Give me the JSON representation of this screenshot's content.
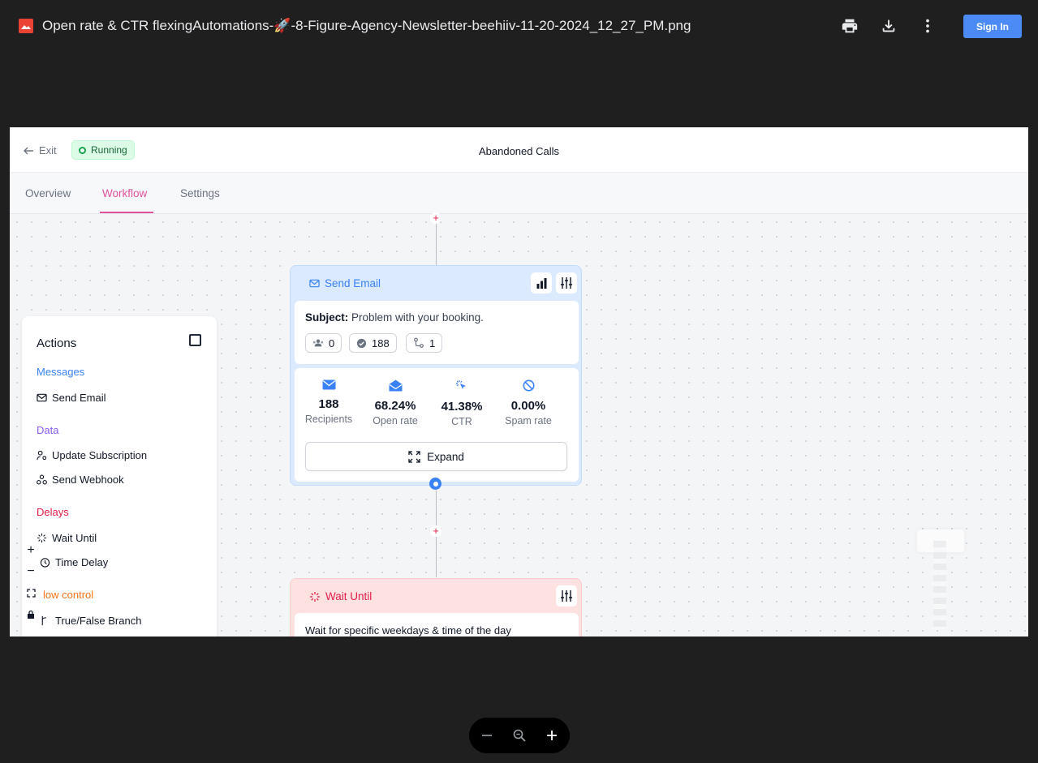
{
  "viewer": {
    "file_name": "Open rate & CTR flexingAutomations-🚀-8-Figure-Agency-Newsletter-beehiiv-11-20-2024_12_27_PM.png",
    "sign_in_label": "Sign In",
    "icons": [
      "image-file-icon",
      "print-icon",
      "download-icon",
      "more-vert-icon",
      "zoom-out-icon",
      "zoom-icon",
      "zoom-in-icon"
    ]
  },
  "app": {
    "exit_label": "Exit",
    "status_label": "Running",
    "title": "Abandoned Calls",
    "tabs": [
      {
        "label": "Overview",
        "active": false
      },
      {
        "label": "Workflow",
        "active": true
      },
      {
        "label": "Settings",
        "active": false
      }
    ]
  },
  "send_email_card": {
    "title": "Send Email",
    "subject_label": "Subject:",
    "subject_value": "Problem with your booking.",
    "pills": [
      "0",
      "188",
      "1"
    ],
    "stats": [
      {
        "value": "188",
        "label": "Recipients"
      },
      {
        "value": "68.24%",
        "label": "Open rate"
      },
      {
        "value": "41.38%",
        "label": "CTR"
      },
      {
        "value": "0.00%",
        "label": "Spam rate"
      }
    ],
    "expand_label": "Expand"
  },
  "wait_card": {
    "title": "Wait Until",
    "description": "Wait for specific weekdays & time of the day"
  },
  "actions_panel": {
    "title": "Actions",
    "sections": [
      {
        "label": "Messages",
        "color": "#3b82f6",
        "items": [
          "Send Email"
        ]
      },
      {
        "label": "Data",
        "color": "#8b5cf6",
        "items": [
          "Update Subscription",
          "Send Webhook"
        ]
      },
      {
        "label": "Delays",
        "color": "#e11d48",
        "items": [
          "Wait Until",
          "Time Delay"
        ]
      },
      {
        "label": "low control",
        "color": "#f97316",
        "items": [
          "True/False Branch"
        ]
      }
    ]
  },
  "colors": {
    "accent_pink": "#e0529c",
    "email_blue": "#3b82f6",
    "delay_red": "#e11d48",
    "running_green": "#16a34a",
    "signin_blue": "#4c8bf5"
  }
}
